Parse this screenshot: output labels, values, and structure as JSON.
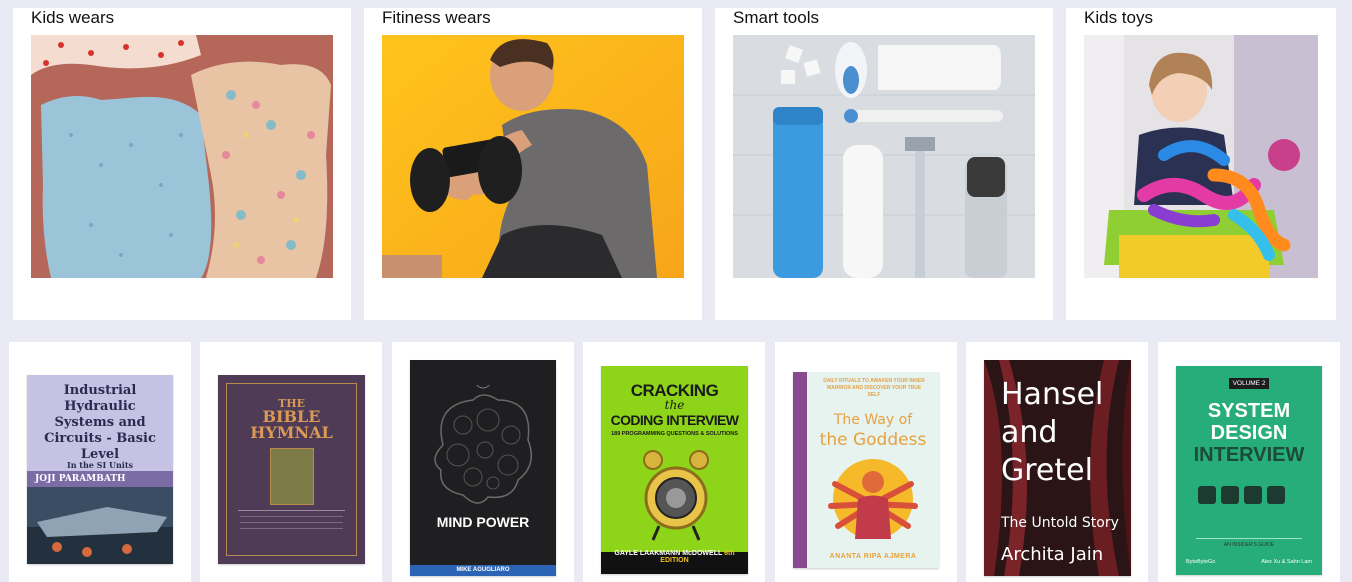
{
  "categories": [
    {
      "title": "Kids wears",
      "image": "kids-dresses-photo"
    },
    {
      "title": "Fitiness wears",
      "image": "man-lifting-dumbbell-photo"
    },
    {
      "title": "Smart tools",
      "image": "grooming-tools-photo"
    },
    {
      "title": "Kids toys",
      "image": "child-playing-toy-photo"
    }
  ],
  "books": {
    "b1": {
      "title": "Industrial Hydraulic Systems and Circuits - Basic Level",
      "sub": "In the SI Units",
      "author": "JOJI PARAMBATH"
    },
    "b2": {
      "title1": "THE",
      "title2": "BIBLE",
      "title3": "HYMNAL"
    },
    "b3": {
      "title": "MIND POWER",
      "author": "MIKE AGUGLIARO"
    },
    "b4": {
      "title1": "CRACKING",
      "title2": "the",
      "title3": "CODING INTERVIEW",
      "sub": "189 PROGRAMMING QUESTIONS & SOLUTIONS",
      "author": "GAYLE LAAKMANN McDOWELL",
      "edition": "6th EDITION"
    },
    "b5": {
      "tagline": "DAILY RITUALS TO AWAKEN YOUR INNER WARRIOR AND DISCOVER YOUR TRUE SELF",
      "title1": "The Way of",
      "title2": "the Goddess",
      "author": "ANANTA RIPA AJMERA"
    },
    "b6": {
      "title1": "Hansel",
      "title2": "and",
      "title3": "Gretel",
      "sub": "The Untold Story",
      "author": "Archita Jain"
    },
    "b7": {
      "volume": "VOLUME 2",
      "title1": "SYSTEM",
      "title2": "DESIGN",
      "title3": "INTERVIEW",
      "sub": "AN INSIDER'S GUIDE",
      "publisher": "ByteByteGo",
      "authors": "Alex Xu & Sahn Lam"
    }
  }
}
